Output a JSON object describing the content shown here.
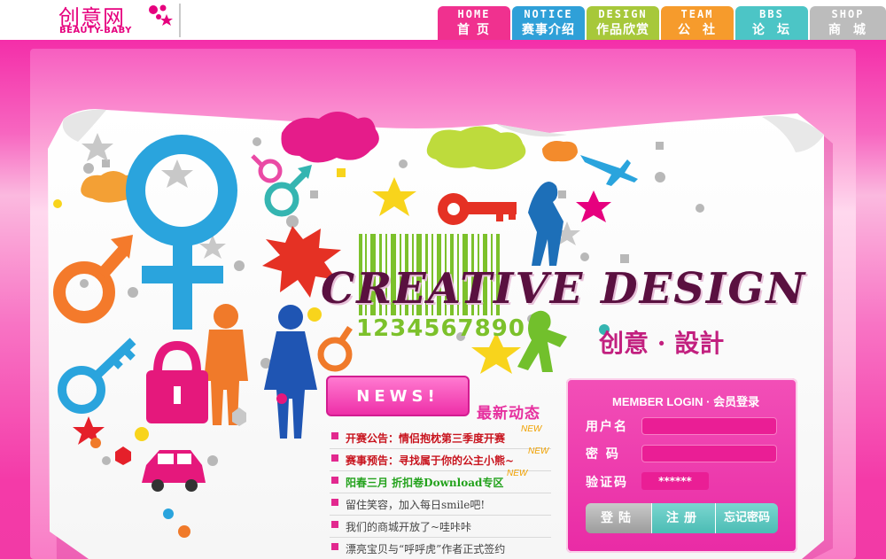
{
  "logo": {
    "text_cn": "创意网",
    "text_en": "BEAUTY-BABY"
  },
  "nav": [
    {
      "en": "HOME",
      "cn": "首页",
      "color": "#f0318f"
    },
    {
      "en": "NOTICE",
      "cn": "赛事介绍",
      "color": "#2fa0d8"
    },
    {
      "en": "DESIGN",
      "cn": "作品欣赏",
      "color": "#a7c83a"
    },
    {
      "en": "TEAM",
      "cn": "公社",
      "color": "#f69b2c"
    },
    {
      "en": "BBS",
      "cn": "论坛",
      "color": "#4cc5c6"
    },
    {
      "en": "SHOP",
      "cn": "商城",
      "color": "#bcbcbc"
    }
  ],
  "banner": {
    "title": "CREATIVE DESIGN",
    "subtitle_cn": "创意 · 設計",
    "barcode_number": "1234567890"
  },
  "news": {
    "button_label": "NEWS!",
    "heading_cn": "最新动态",
    "new_tag": "NEW",
    "items": [
      {
        "text": "开赛公告：情侣抱枕第三季度开赛",
        "style": "red",
        "is_new": true
      },
      {
        "text": "赛事预告：寻找属于你的公主小熊~",
        "style": "red",
        "is_new": true
      },
      {
        "text": "阳春三月 折扣卷Download专区",
        "style": "green",
        "is_new": true
      },
      {
        "text": "留住笑容，加入每日smile吧!",
        "style": "grey",
        "is_new": false
      },
      {
        "text": "我们的商城开放了~哇咔咔",
        "style": "grey",
        "is_new": false
      },
      {
        "text": "漂亮宝贝与“呼呼虎”作者正式签约",
        "style": "grey",
        "is_new": false
      }
    ]
  },
  "login": {
    "title": "MEMBER LOGIN  · 会员登录",
    "username_label": "用户名",
    "password_label": "密 码",
    "captcha_label": "验证码",
    "captcha_value": "******",
    "login_button": "登陆",
    "register_button": "注册",
    "forgot_button": "忘记密码"
  },
  "colors": {
    "brand_pink": "#e6007e",
    "panel_pink": "#ec34aa",
    "teal": "#4bbcb4"
  }
}
